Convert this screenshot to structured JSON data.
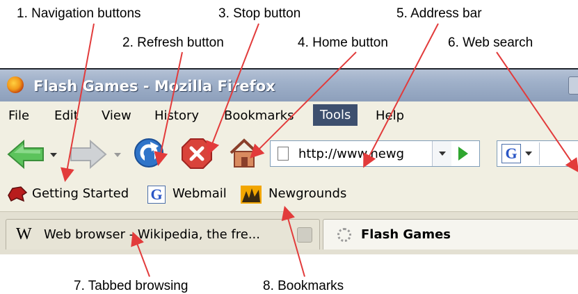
{
  "callouts": {
    "nav_buttons": "1. Navigation buttons",
    "refresh": "2. Refresh button",
    "stop": "3. Stop button",
    "home": "4. Home button",
    "address": "5. Address bar",
    "search": "6. Web search",
    "tabs": "7. Tabbed browsing",
    "bookmarks": "8. Bookmarks"
  },
  "window": {
    "title": "Flash Games - Mozilla Firefox"
  },
  "menu": {
    "items": [
      "File",
      "Edit",
      "View",
      "History",
      "Bookmarks",
      "Tools",
      "Help"
    ],
    "active": "Tools"
  },
  "navbar": {
    "url": "http://www.newg",
    "search_engine_letter": "G",
    "icons": [
      "back-arrow-icon",
      "forward-arrow-icon",
      "refresh-icon",
      "stop-icon",
      "home-icon",
      "go-arrow-icon"
    ]
  },
  "bookmarks": {
    "items": [
      "Getting Started",
      "Webmail",
      "Newgrounds"
    ]
  },
  "tabs": {
    "items": [
      {
        "favicon": "W",
        "label": "Web browser - Wikipedia, the fre..."
      },
      {
        "label": "Flash Games"
      }
    ]
  },
  "colors": {
    "title_gradient_top": "#b4c1d5",
    "menu_active_bg": "#3d4f6e",
    "back_arrow": "#5cc35c",
    "stop_red": "#d9433a",
    "refresh_blue": "#2f74c9",
    "arrow_red": "#e23b3b"
  }
}
